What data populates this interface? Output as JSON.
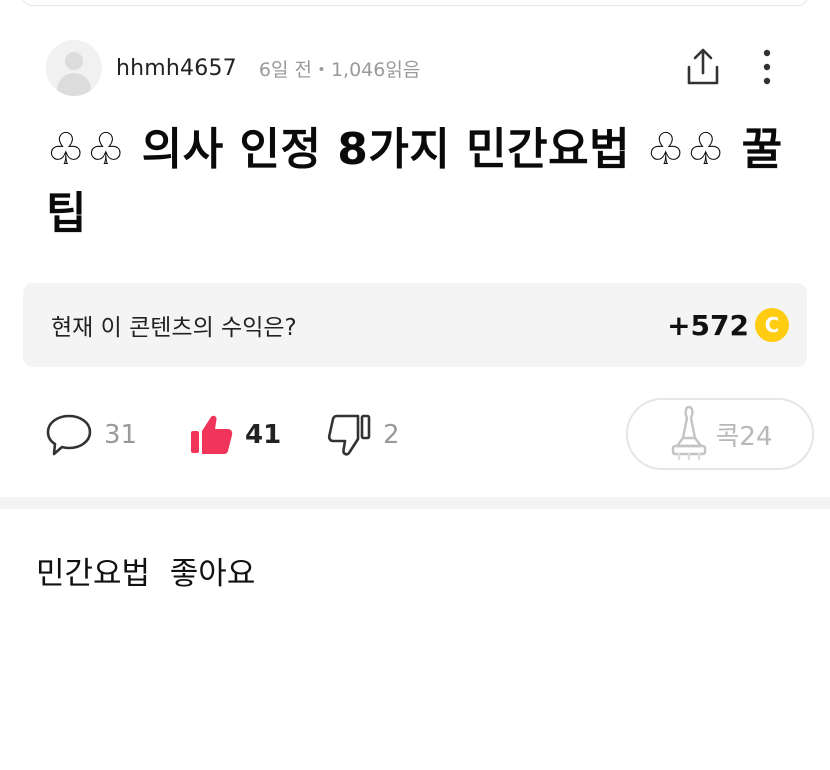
{
  "author": {
    "name": "hhmh4657",
    "meta": "6일 전・1,046읽음"
  },
  "post": {
    "title": "♧♧ 의사 인정 8가지 민간요법 ♧♧ 꿀팁",
    "body": "민간요법  좋아요"
  },
  "revenue": {
    "label": "현재 이 콘텐츠의 수익은?",
    "value": "+572",
    "coin_symbol": "C"
  },
  "actions": {
    "comments": "31",
    "likes": "41",
    "dislikes": "2",
    "kok_label": "콕24"
  },
  "colors": {
    "like_accent": "#f0345a",
    "coin": "#ffcc11"
  }
}
